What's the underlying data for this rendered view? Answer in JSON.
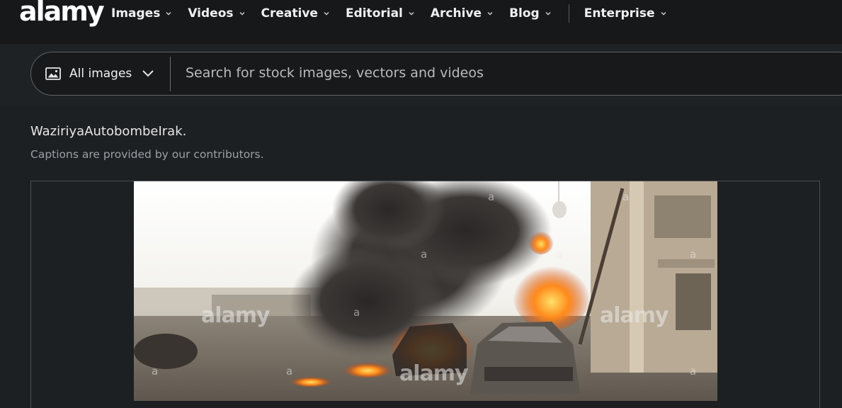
{
  "brand": {
    "logo_text": "alamy"
  },
  "nav": {
    "items": [
      {
        "label": "Images"
      },
      {
        "label": "Videos"
      },
      {
        "label": "Creative"
      },
      {
        "label": "Editorial"
      },
      {
        "label": "Archive"
      },
      {
        "label": "Blog"
      },
      {
        "label": "Enterprise"
      }
    ]
  },
  "search": {
    "filter_label": "All images",
    "placeholder": "Search for stock images, vectors and videos",
    "value": ""
  },
  "caption": {
    "title": "WaziriyaAutobombeIrak.",
    "note": "Captions are provided by our contributors."
  },
  "photo": {
    "watermark": "alamy",
    "watermark_small": "a"
  },
  "colors": {
    "background": "#1d2022",
    "topbar": "#16181a",
    "text": "#e8e8e8",
    "muted": "#9aa0a4"
  }
}
